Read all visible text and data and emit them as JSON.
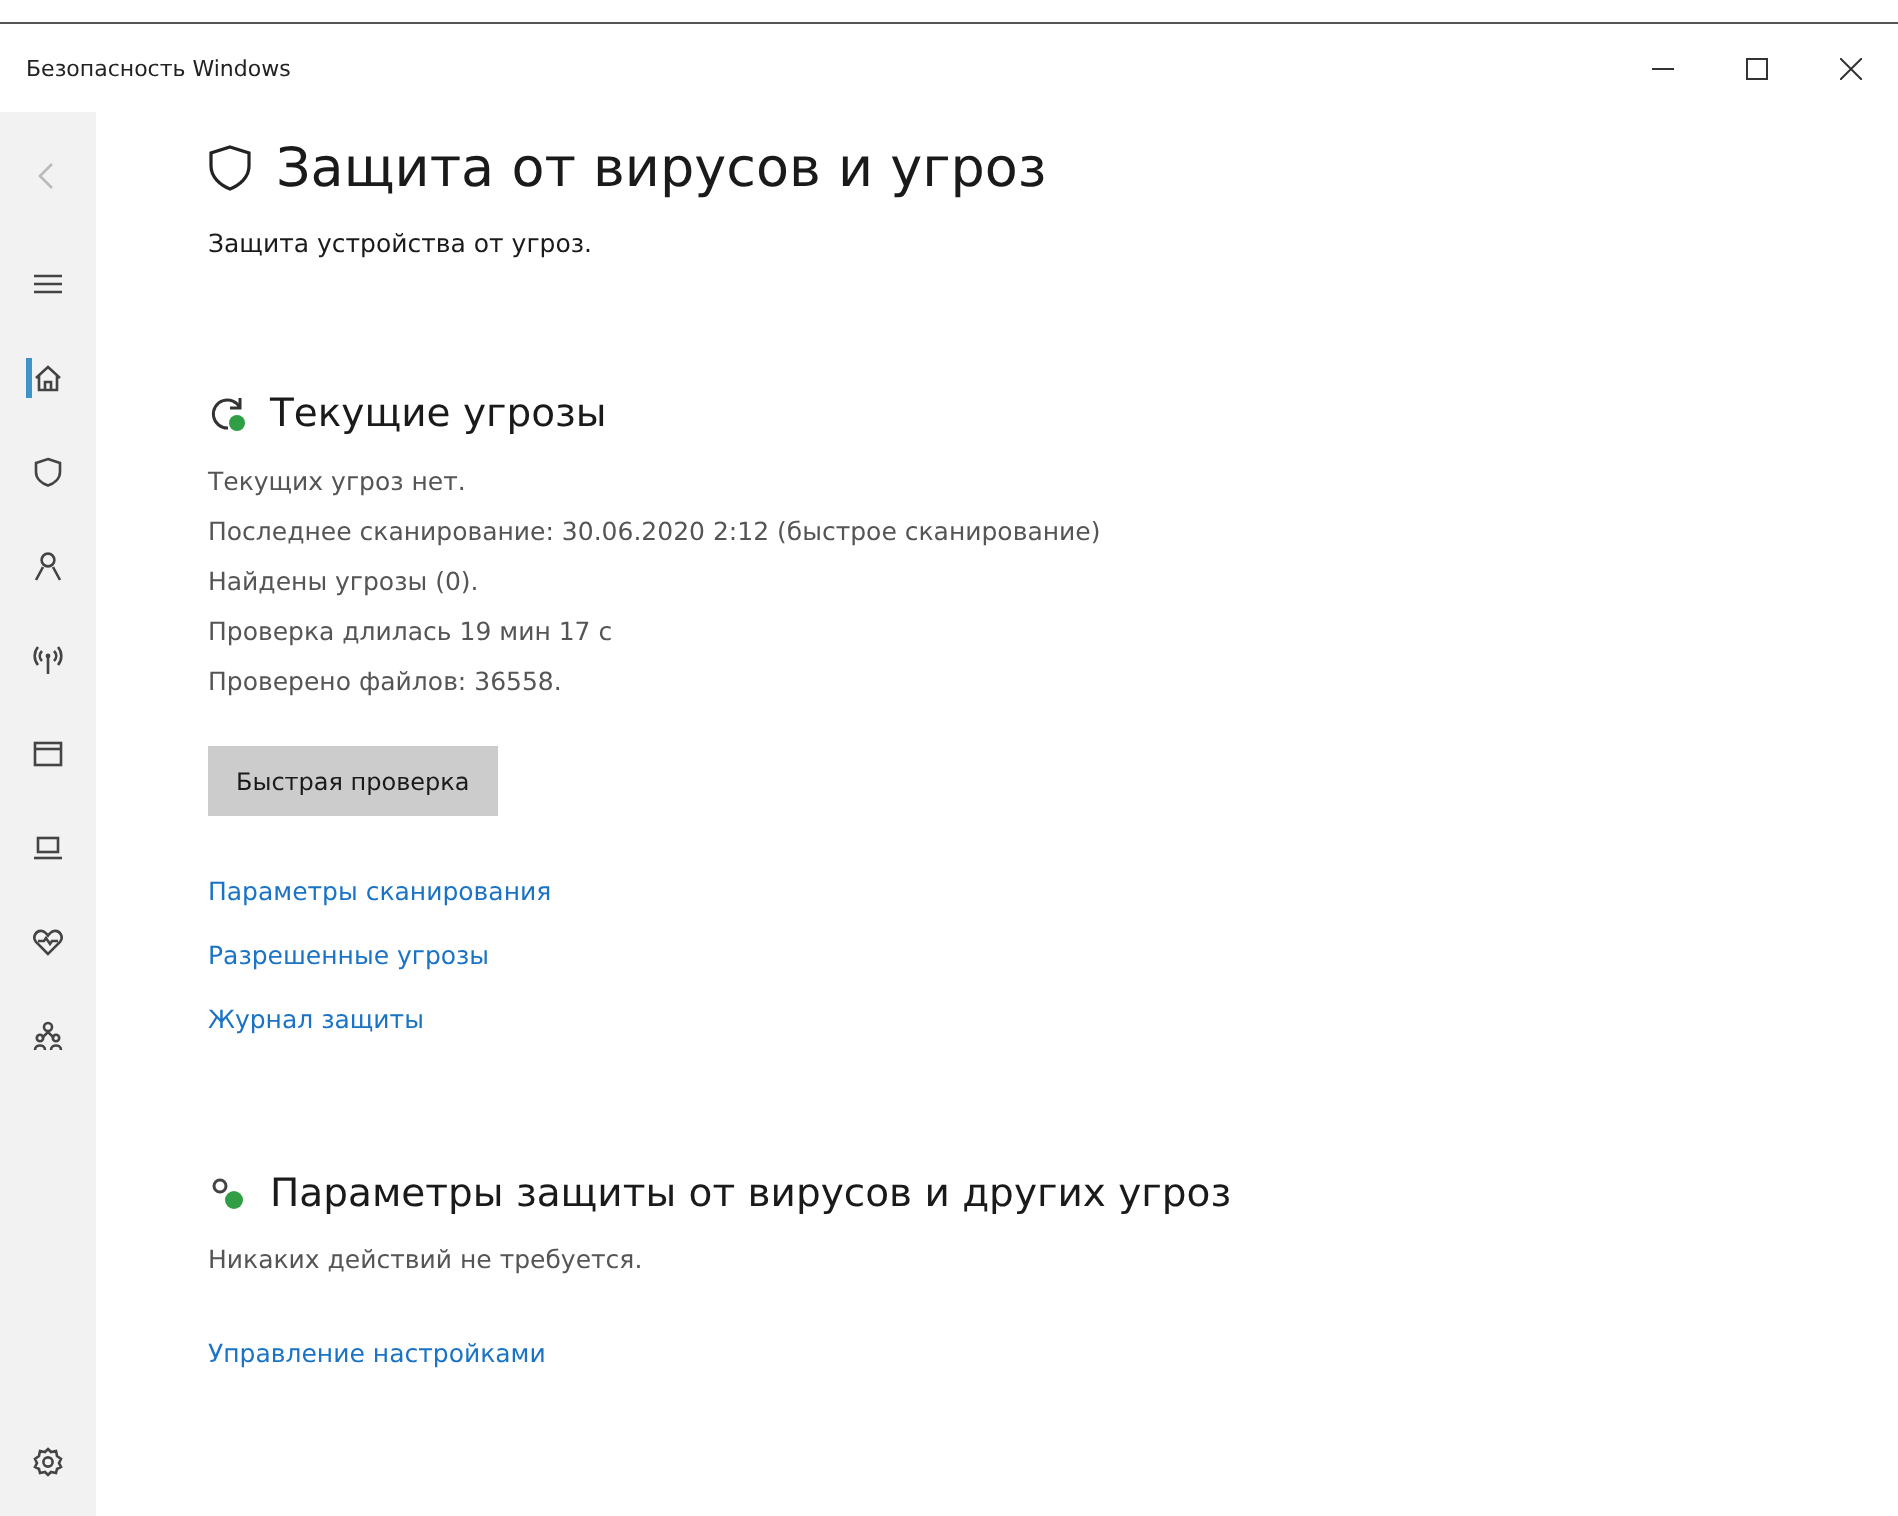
{
  "window": {
    "title": "Безопасность Windows"
  },
  "sidebar": {
    "items": [
      {
        "kind": "home",
        "selected": true
      },
      {
        "kind": "shield",
        "selected": false
      },
      {
        "kind": "person",
        "selected": false
      },
      {
        "kind": "antenna",
        "selected": false
      },
      {
        "kind": "app-window",
        "selected": false
      },
      {
        "kind": "laptop",
        "selected": false
      },
      {
        "kind": "heart",
        "selected": false
      },
      {
        "kind": "family",
        "selected": false
      }
    ]
  },
  "page": {
    "title": "Защита от вирусов и угроз",
    "subtitle": "Защита устройства от угроз."
  },
  "current_threats": {
    "heading": "Текущие угрозы",
    "lines": [
      "Текущих угроз нет.",
      "Последнее сканирование: 30.06.2020 2:12 (быстрое сканирование)",
      "Найдены угрозы (0).",
      "Проверка длилась 19 мин 17 с",
      "Проверено файлов: 36558."
    ],
    "button": "Быстрая проверка",
    "links": [
      "Параметры сканирования",
      "Разрешенные угрозы",
      "Журнал защиты"
    ]
  },
  "protection_settings": {
    "heading": "Параметры защиты от вирусов и других угроз",
    "status": "Никаких действий не требуется.",
    "link": "Управление настройками"
  }
}
